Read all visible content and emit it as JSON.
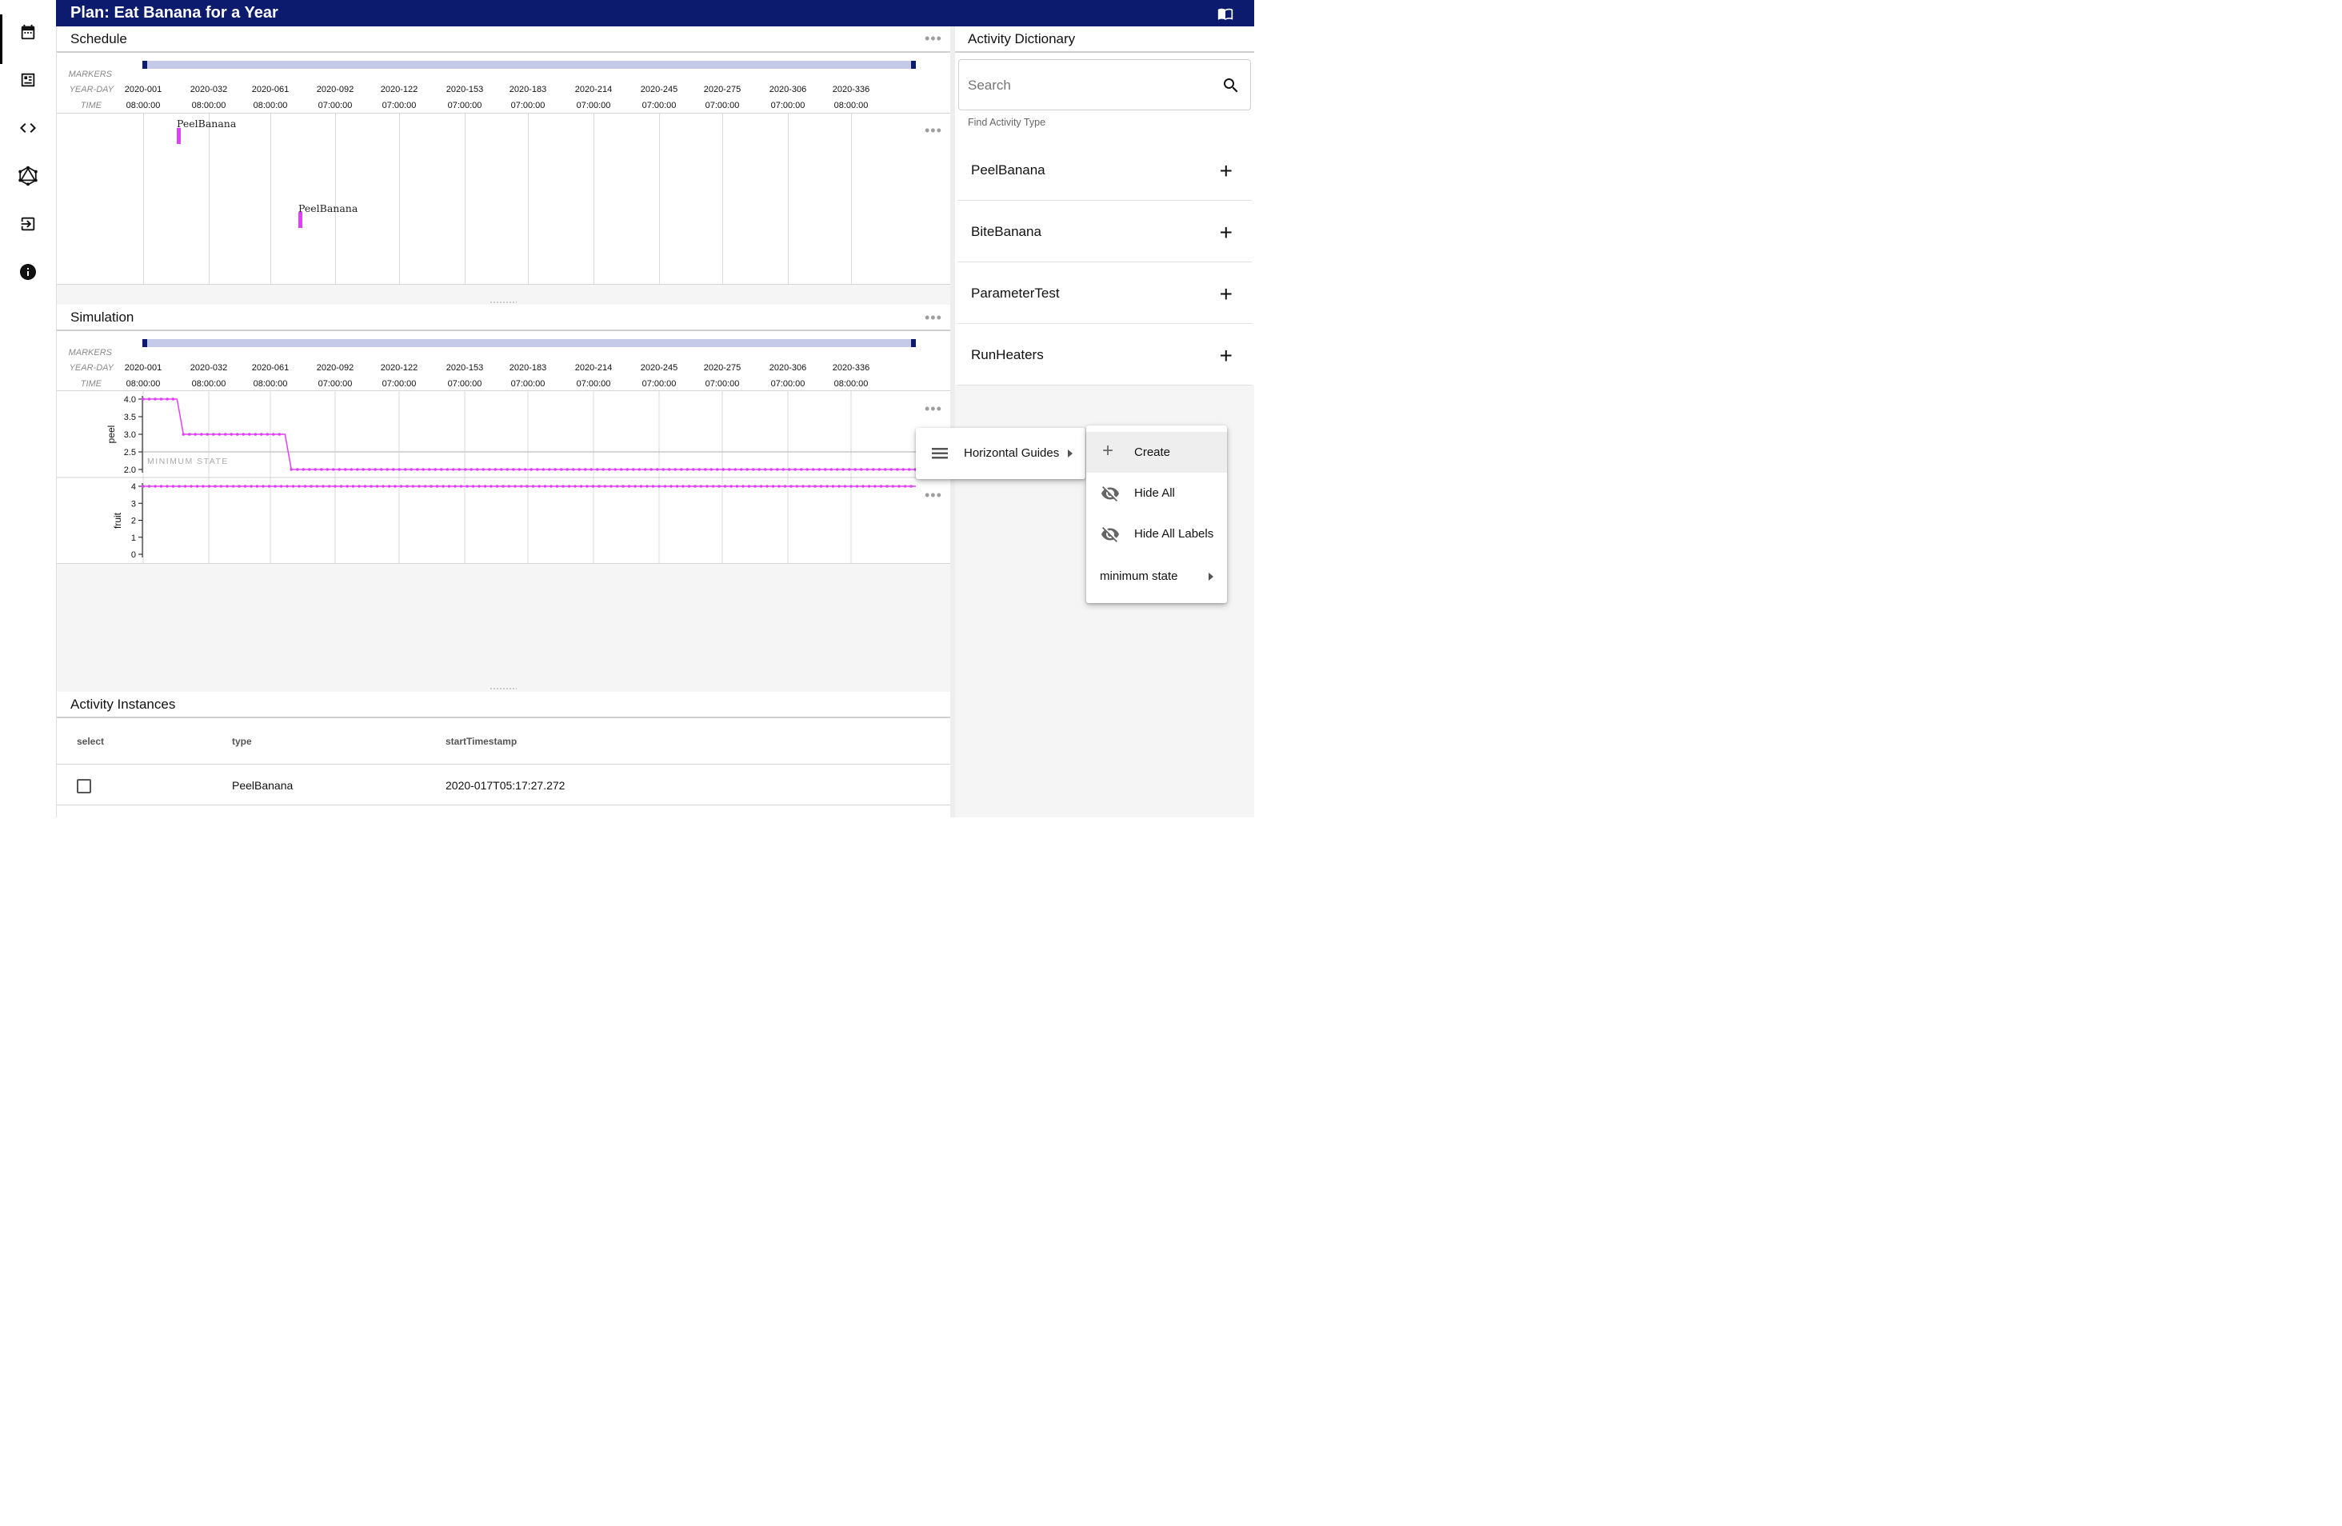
{
  "plan": {
    "title": "Plan: Eat Banana for a Year"
  },
  "nav": {
    "items": [
      {
        "name": "calendar-icon"
      },
      {
        "name": "dashboard-icon"
      },
      {
        "name": "code-icon"
      },
      {
        "name": "graphql-icon"
      },
      {
        "name": "logout-icon"
      },
      {
        "name": "info-icon"
      }
    ]
  },
  "schedule": {
    "title": "Schedule",
    "axis": {
      "markers": "MARKERS",
      "year_day": "YEAR-DAY",
      "time": "TIME"
    },
    "ticks": [
      {
        "day": "2020-001",
        "time": "08:00:00"
      },
      {
        "day": "2020-032",
        "time": "08:00:00"
      },
      {
        "day": "2020-061",
        "time": "08:00:00"
      },
      {
        "day": "2020-092",
        "time": "07:00:00"
      },
      {
        "day": "2020-122",
        "time": "07:00:00"
      },
      {
        "day": "2020-153",
        "time": "07:00:00"
      },
      {
        "day": "2020-183",
        "time": "07:00:00"
      },
      {
        "day": "2020-214",
        "time": "07:00:00"
      },
      {
        "day": "2020-245",
        "time": "07:00:00"
      },
      {
        "day": "2020-275",
        "time": "07:00:00"
      },
      {
        "day": "2020-306",
        "time": "07:00:00"
      },
      {
        "day": "2020-336",
        "time": "08:00:00"
      }
    ],
    "activities": [
      {
        "label": "PeelBanana"
      },
      {
        "label": "PeelBanana"
      }
    ]
  },
  "simulation": {
    "title": "Simulation",
    "axis": {
      "markers": "MARKERS",
      "year_day": "YEAR-DAY",
      "time": "TIME"
    },
    "guide_label": "MINIMUM STATE"
  },
  "chart_data": [
    {
      "type": "line",
      "ylabel": "peel",
      "yticks": [
        "4.0",
        "3.5",
        "3.0",
        "2.5",
        "2.0"
      ],
      "ylim": [
        2.0,
        4.0
      ],
      "x": [
        "2020-001",
        "2020-017",
        "2020-020",
        "2020-068",
        "2020-071",
        "2021-001"
      ],
      "values": [
        4.0,
        4.0,
        3.0,
        3.0,
        2.0,
        2.0
      ],
      "color": "#e040fb",
      "horizontal_guide": {
        "label": "MINIMUM STATE",
        "value": 2.5
      }
    },
    {
      "type": "line",
      "ylabel": "fruit",
      "yticks": [
        "4",
        "3",
        "2",
        "1",
        "0"
      ],
      "ylim": [
        0,
        4
      ],
      "x": [
        "2020-001",
        "2021-001"
      ],
      "values": [
        4,
        4
      ],
      "color": "#e040fb"
    }
  ],
  "context_menu": {
    "horizontal_guides": "Horizontal Guides",
    "submenu": {
      "create": "Create",
      "hide_all": "Hide All",
      "hide_all_labels": "Hide All Labels",
      "minimum_state": "minimum state"
    }
  },
  "activity_instances": {
    "title": "Activity Instances",
    "columns": [
      "select",
      "type",
      "startTimestamp"
    ],
    "rows": [
      {
        "type": "PeelBanana",
        "startTimestamp": "2020-017T05:17:27.272"
      }
    ]
  },
  "dictionary": {
    "title": "Activity Dictionary",
    "search_placeholder": "Search",
    "search_hint": "Find Activity Type",
    "items": [
      "PeelBanana",
      "BiteBanana",
      "ParameterTest",
      "RunHeaters"
    ]
  }
}
